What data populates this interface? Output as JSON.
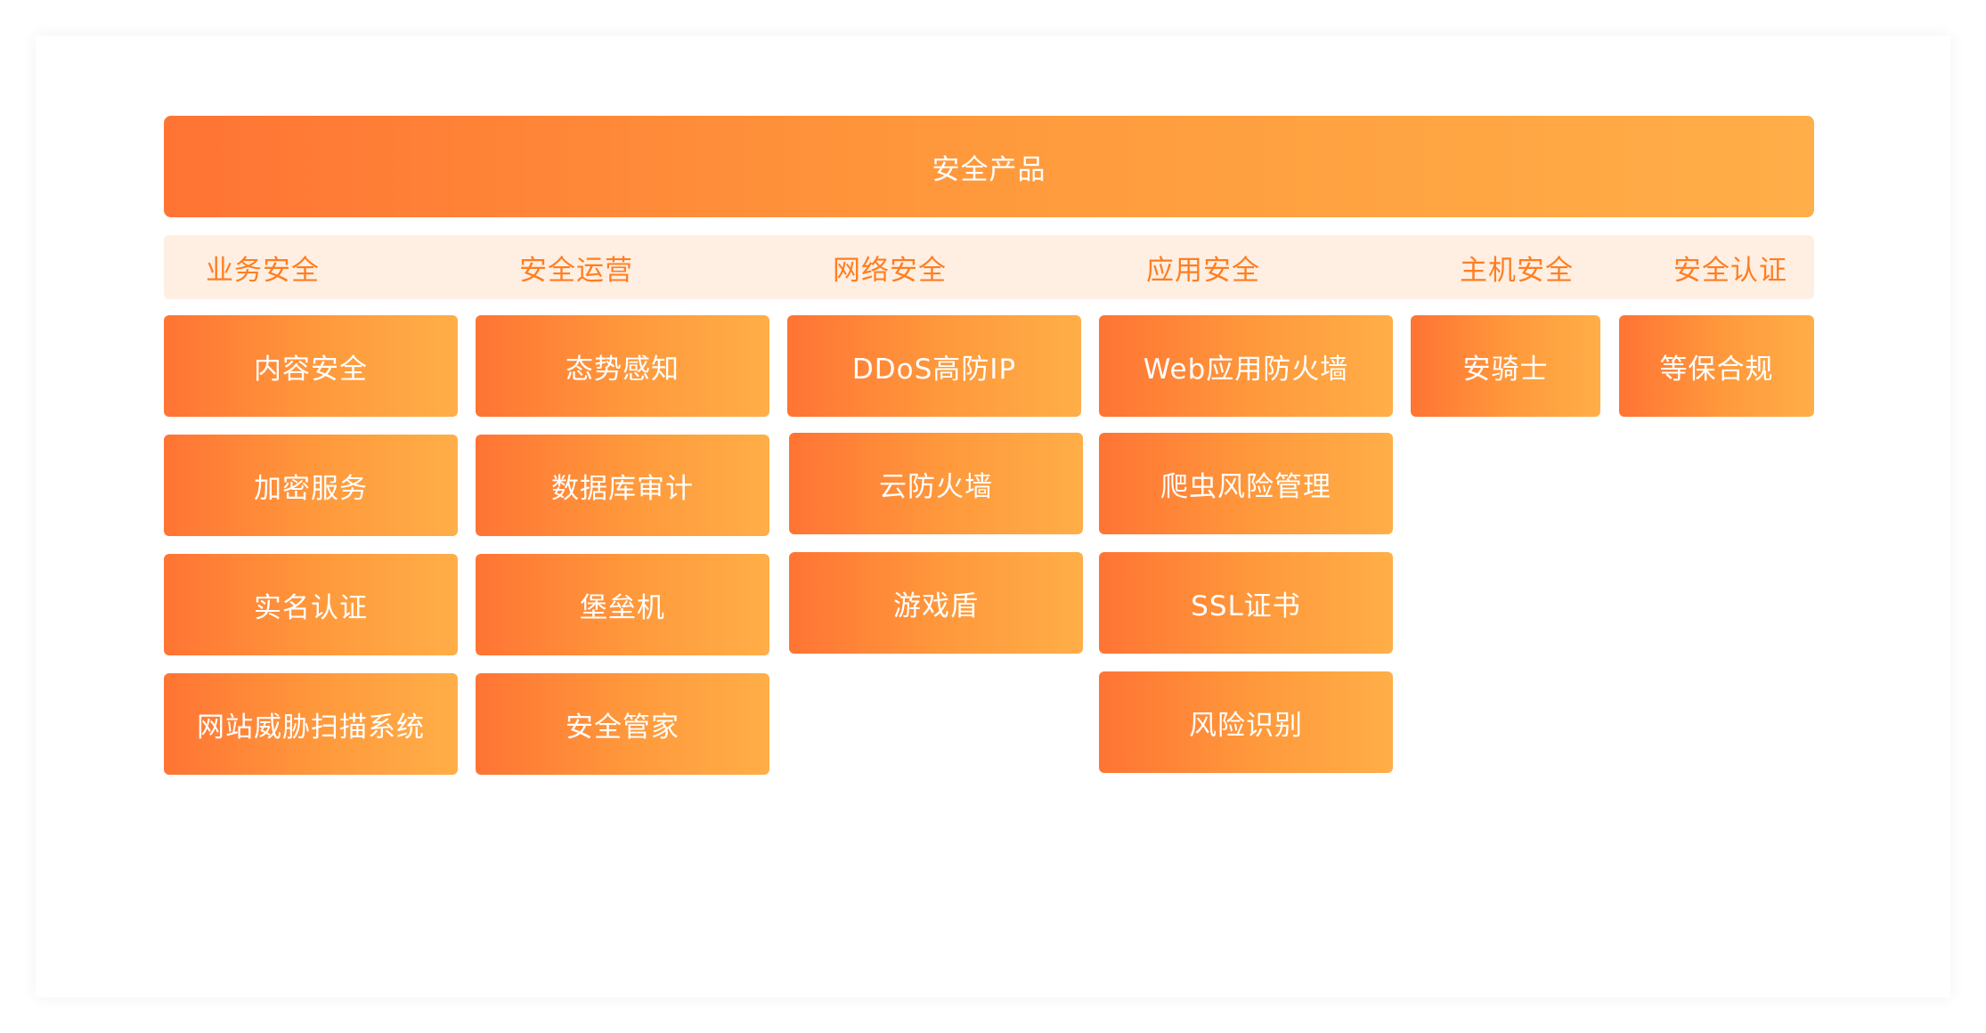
{
  "diagram": {
    "title": "安全产品",
    "categories": [
      "业务安全",
      "安全运营",
      "网络安全",
      "应用安全",
      "主机安全",
      "安全认证"
    ],
    "columns": [
      [
        "内容安全",
        "加密服务",
        "实名认证",
        "网站威胁扫描系统"
      ],
      [
        "态势感知",
        "数据库审计",
        "堡垒机",
        "安全管家"
      ],
      [
        "DDoS高防IP",
        "云防火墙",
        "游戏盾"
      ],
      [
        "Web应用防火墙",
        "爬虫风险管理",
        "SSL证书",
        "风险识别"
      ],
      [
        "安骑士"
      ],
      [
        "等保合规"
      ]
    ]
  },
  "colors": {
    "gradient_start": "#ff7434",
    "gradient_end": "#ffae48",
    "category_bar_bg": "#ffefe2",
    "category_text": "#ff7e22",
    "tile_text": "#ffffff"
  }
}
